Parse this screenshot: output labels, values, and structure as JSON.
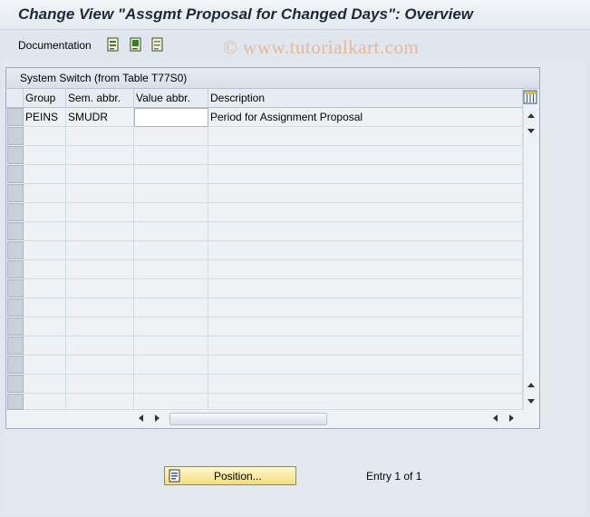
{
  "window": {
    "title": "Change View \"Assgmt Proposal for Changed Days\": Overview"
  },
  "toolbar": {
    "documentation_label": "Documentation",
    "icons": [
      "select-all-icon",
      "select-block-icon",
      "deselect-all-icon"
    ],
    "watermark": "© www.tutorialkart.com"
  },
  "panel": {
    "title": "System Switch (from Table T77S0)",
    "columns": [
      "Group",
      "Sem. abbr.",
      "Value abbr.",
      "Description"
    ],
    "rows": [
      {
        "group": "PEINS",
        "sem_abbr": "SMUDR",
        "value_abbr": "",
        "description": "Period for Assignment Proposal"
      }
    ]
  },
  "footer": {
    "position_button_label": "Position...",
    "entry_text": "Entry 1 of 1"
  },
  "colors": {
    "title_text": "#1b2a3a",
    "button_face": "#f5de7a",
    "watermark": "#e8b89a"
  }
}
